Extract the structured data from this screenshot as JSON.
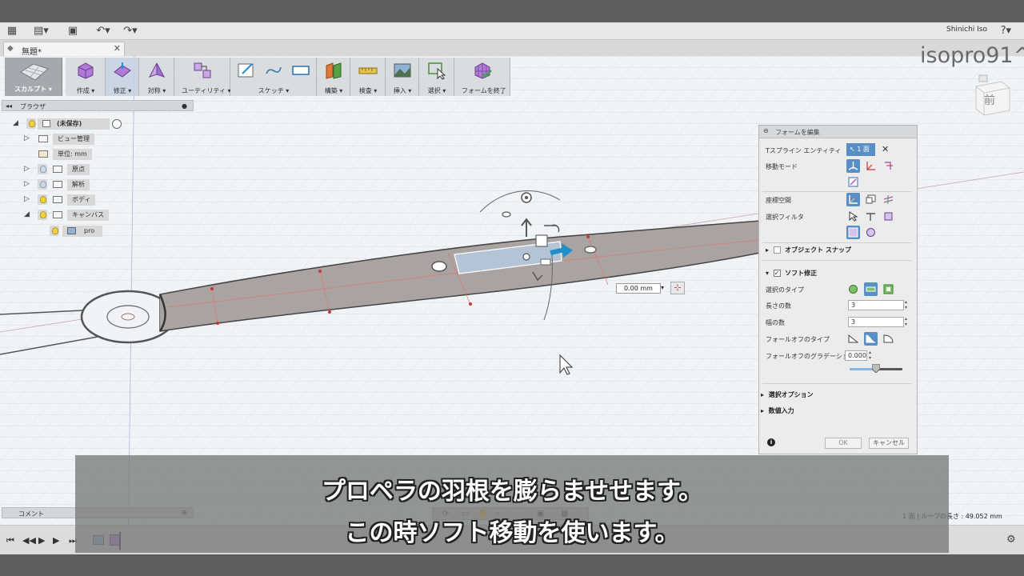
{
  "app": {
    "user_name": "Shinichi Iso",
    "tab_title": "無題*",
    "watermark": "isopro91^"
  },
  "toolbar": {
    "sculpt_label": "スカルプト ▾",
    "groups": [
      {
        "label": "作成 ▾",
        "icon": "create-box-icon"
      },
      {
        "label": "修正 ▾",
        "icon": "modify-icon"
      },
      {
        "label": "対称 ▾",
        "icon": "symmetry-icon"
      },
      {
        "label": "ユーティリティ ▾",
        "icon": "utility-icon"
      },
      {
        "label": "スケッチ ▾",
        "icon": "sketch-icon"
      },
      {
        "label": "構築 ▾",
        "icon": "construct-icon"
      },
      {
        "label": "検査 ▾",
        "icon": "inspect-icon"
      },
      {
        "label": "挿入 ▾",
        "icon": "insert-icon"
      },
      {
        "label": "選択 ▾",
        "icon": "select-icon"
      },
      {
        "label": "フォームを終了",
        "icon": "finish-form-icon"
      }
    ]
  },
  "browser": {
    "title": "ブラウザ",
    "root": "(未保存)",
    "items": [
      {
        "label": "ビュー管理"
      },
      {
        "label": "単位: mm"
      },
      {
        "label": "原点"
      },
      {
        "label": "解析"
      },
      {
        "label": "ボディ"
      },
      {
        "label": "キャンバス"
      },
      {
        "label": "pro"
      }
    ]
  },
  "comment_label": "コメント",
  "viewcube_label": "前",
  "move_input": "0.00 mm",
  "panel": {
    "title": "フォームを編集",
    "t_spline_label": "Tスプライン エンティティ",
    "t_spline_value": "1 面",
    "move_mode_label": "移動モード",
    "coord_space_label": "座標空間",
    "select_filter_label": "選択フィルタ",
    "object_snap_label": "オブジェクト スナップ",
    "soft_modify_label": "ソフト修正",
    "select_type_label": "選択のタイプ",
    "length_count_label": "長さの数",
    "length_count_value": "3",
    "width_count_label": "幅の数",
    "width_count_value": "3",
    "falloff_type_label": "フォールオフのタイプ",
    "falloff_grad_label": "フォールオフのグラデーション",
    "falloff_grad_value": "0.000",
    "falloff_slider": 0.5,
    "select_options_label": "選択オプション",
    "numeric_input_label": "数値入力",
    "ok_label": "OK",
    "cancel_label": "キャンセル"
  },
  "status": "1 面 | ループの長さ : 49.052 mm",
  "subtitles": [
    "プロペラの羽根を膨らませせます。",
    "この時ソフト移動を使います。"
  ]
}
